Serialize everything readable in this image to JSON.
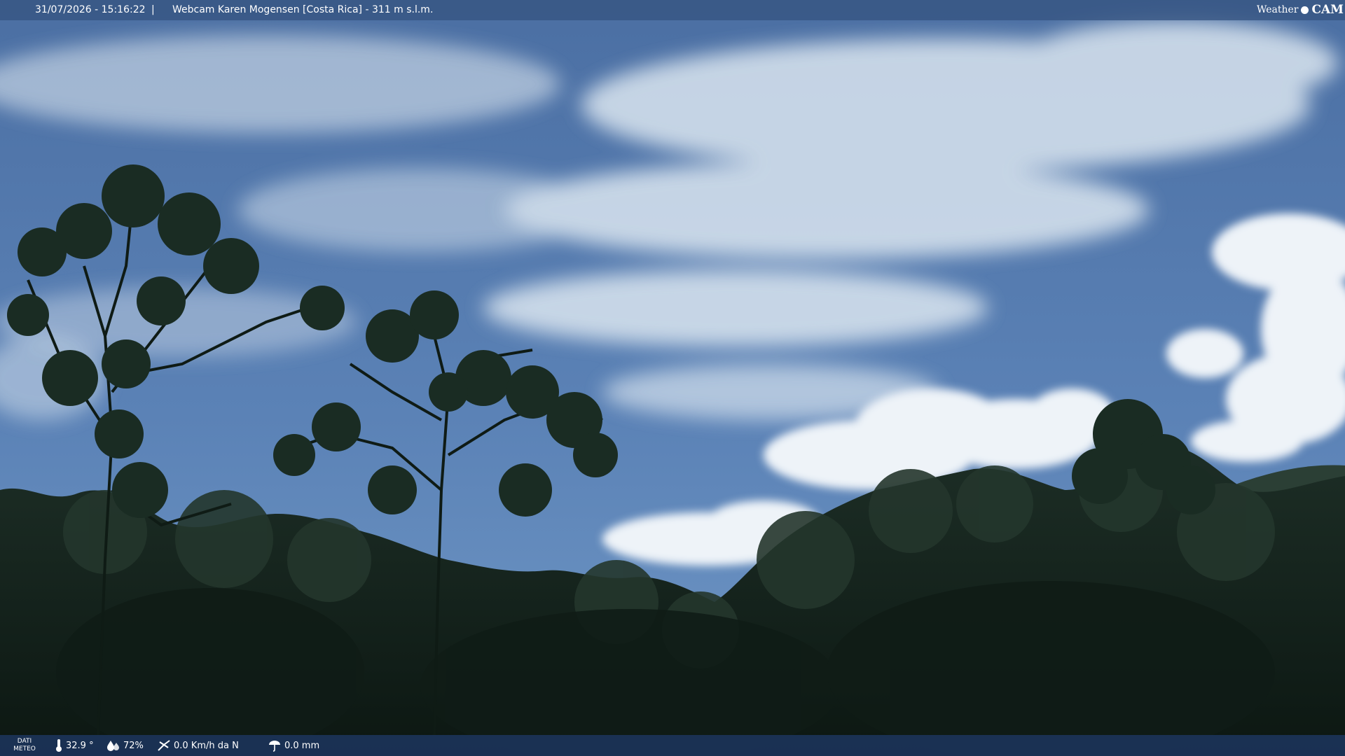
{
  "header": {
    "datetime": "31/07/2026 - 15:16:22",
    "separator": "|",
    "title": "Webcam Karen Mogensen [Costa Rica]  - 311 m s.l.m."
  },
  "brand": {
    "weather": "Weather",
    "cam": "CAM"
  },
  "footer": {
    "meteo_label_line1": "DATI",
    "meteo_label_line2": "METEO",
    "temperature": "32.9 °",
    "humidity": "72%",
    "wind": "0.0 Km/h da N",
    "rain": "0.0 mm"
  },
  "icons": {
    "temperature": "thermometer-icon",
    "humidity": "humidity-drops-icon",
    "wind": "wind-icon",
    "rain": "rain-gauge-icon"
  },
  "colors": {
    "sky_top": "#4f74a8",
    "sky_bottom": "#6f95c4",
    "cloud": "#dfe9f2",
    "foliage_dark": "#0f1d17",
    "foliage_mid": "#1f3128",
    "top_bar": "#375582",
    "bottom_bar": "#1c345c"
  }
}
